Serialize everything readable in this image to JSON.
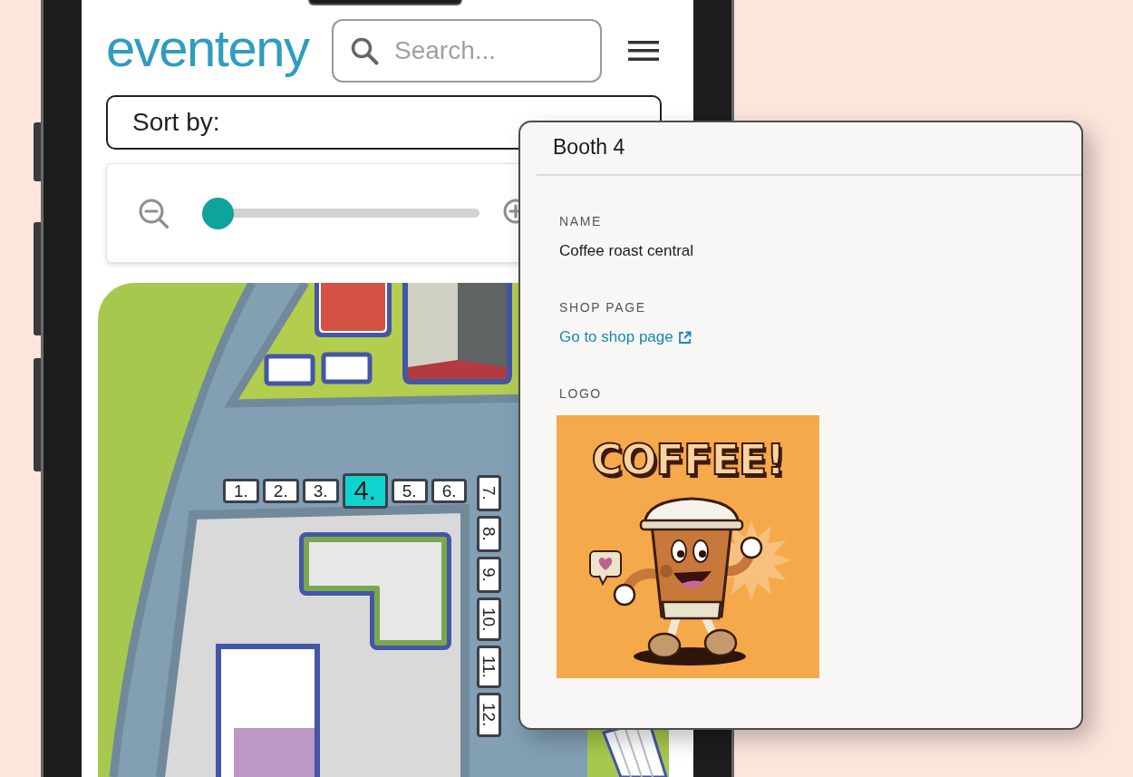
{
  "phone": {
    "header": {
      "logo": "eventeny",
      "search": {
        "placeholder": "Search..."
      }
    },
    "sort": {
      "label": "Sort by:"
    },
    "zoom": {
      "level": 0
    },
    "map": {
      "booth_row": [
        {
          "label": "1.",
          "selected": false
        },
        {
          "label": "2.",
          "selected": false
        },
        {
          "label": "3.",
          "selected": false
        },
        {
          "label": "4.",
          "selected": true
        },
        {
          "label": "5.",
          "selected": false
        },
        {
          "label": "6.",
          "selected": false
        }
      ],
      "booth_column": [
        {
          "label": "7.",
          "selected": false
        },
        {
          "label": "8.",
          "selected": false
        },
        {
          "label": "9.",
          "selected": false
        },
        {
          "label": "10.",
          "selected": false
        },
        {
          "label": "11.",
          "selected": false
        },
        {
          "label": "12.",
          "selected": false
        }
      ]
    }
  },
  "booth_panel": {
    "title": "Booth 4",
    "fields": [
      {
        "kind": "text",
        "label": "NAME",
        "value": "Coffee roast central"
      },
      {
        "kind": "link",
        "label": "SHOP PAGE",
        "value": "Go to shop page"
      },
      {
        "kind": "image",
        "label": "LOGO",
        "image_text": "COFFEE!"
      }
    ]
  }
}
